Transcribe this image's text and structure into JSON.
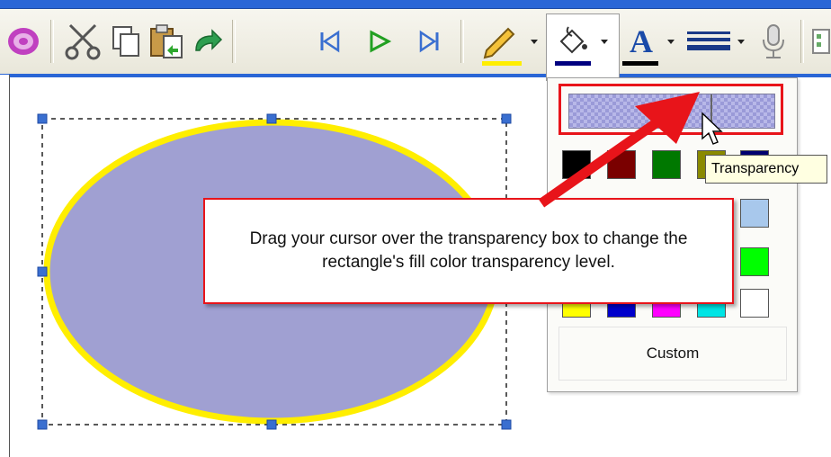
{
  "toolbar": {
    "buttons": [
      {
        "name": "erase-icon"
      },
      {
        "name": "cut-icon"
      },
      {
        "name": "copy-icon"
      },
      {
        "name": "paste-icon"
      },
      {
        "name": "redo-icon"
      },
      {
        "name": "skip-back-icon"
      },
      {
        "name": "play-icon"
      },
      {
        "name": "skip-forward-icon"
      },
      {
        "name": "line-color-icon"
      },
      {
        "name": "fill-color-icon"
      },
      {
        "name": "font-color-icon"
      },
      {
        "name": "line-style-icon"
      },
      {
        "name": "microphone-icon"
      }
    ],
    "colors": {
      "line_color": "#ffee00",
      "fill_color": "#000080",
      "font_color": "#000000"
    }
  },
  "palette": {
    "tooltip": "Transparency",
    "custom_label": "Custom",
    "swatches": [
      [
        "#000000",
        "#7a0000",
        "#007800",
        "#8a8a00",
        "#000070"
      ],
      [
        "",
        "",
        "",
        "",
        "#a8c8ec"
      ],
      [
        "",
        "",
        "",
        "",
        "#00ff00"
      ],
      [
        "#ffff00",
        "#0000cc",
        "#ff00ff",
        "#00e5e5",
        "#ffffff"
      ]
    ]
  },
  "callout": {
    "text": "Drag your cursor over the transparency box to change the rectangle's fill color transparency level."
  },
  "shape": {
    "fill": "#a0a0d2",
    "stroke": "#ffee00"
  },
  "accent": {
    "annotation_red": "#e8141a",
    "selection_blue": "#2a66d6"
  }
}
